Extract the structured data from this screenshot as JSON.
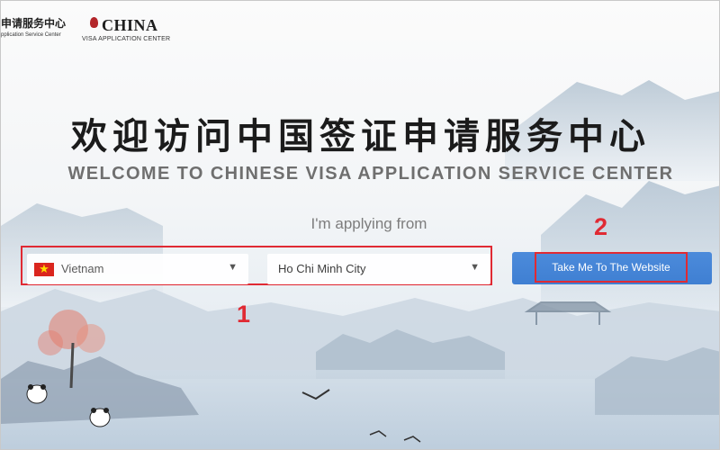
{
  "header": {
    "left_logo_cn": "申请服务中心",
    "left_logo_en": "pplication Service Center",
    "right_logo_brand": "CHINA",
    "right_logo_sub": "VISA APPLICATION CENTER"
  },
  "hero": {
    "title_cn": "欢迎访问中国签证申请服务中心",
    "title_en": "WELCOME TO CHINESE VISA APPLICATION SERVICE CENTER"
  },
  "form": {
    "prompt": "I'm applying from",
    "country": {
      "value": "Vietnam",
      "flag": "vietnam-flag",
      "flag_star": "★"
    },
    "city": {
      "value": "Ho Chi Minh City"
    },
    "caret_glyph": "▼",
    "submit_label": "Take Me To The Website"
  },
  "annotations": {
    "marker_1": "1",
    "marker_2": "2",
    "highlight_color": "#e02a33"
  },
  "colors": {
    "button": "#4383d6",
    "flag_red": "#da251d",
    "flag_star": "#ffde00"
  }
}
